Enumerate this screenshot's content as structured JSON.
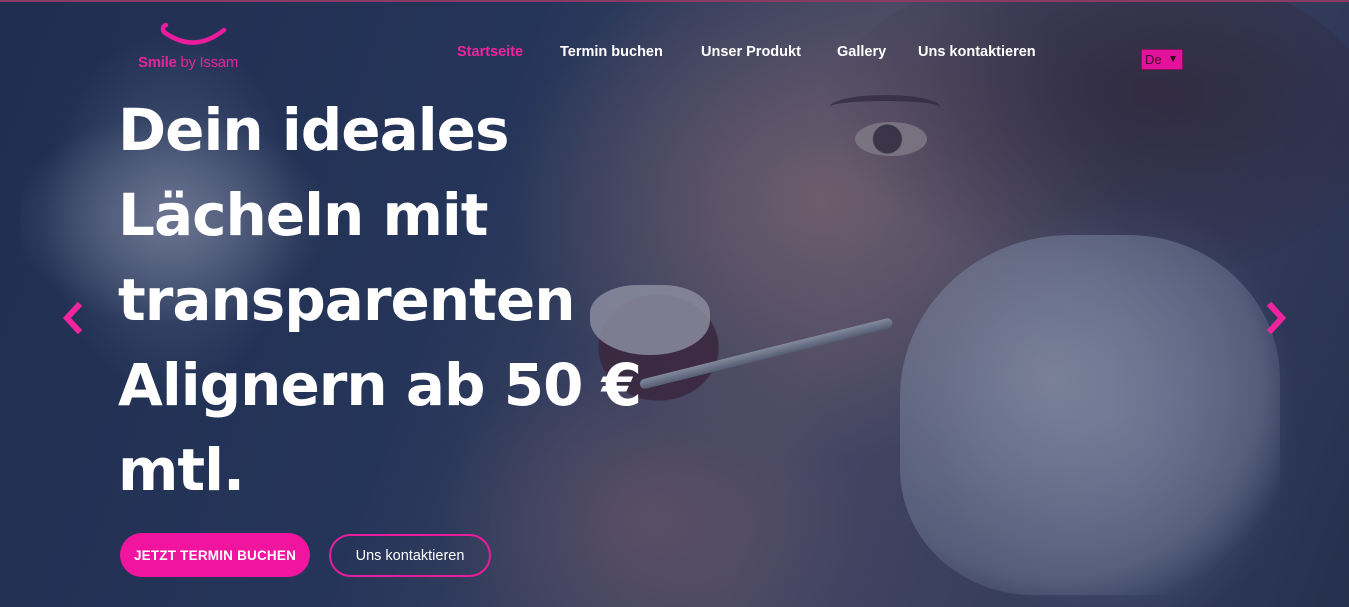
{
  "brand": {
    "logo_bold": "Smile",
    "logo_light": " by Issam",
    "accent_color": "#f0149e"
  },
  "nav": {
    "items": [
      {
        "label": "Startseite",
        "active": true
      },
      {
        "label": "Termin buchen",
        "active": false
      },
      {
        "label": "Unser Produkt",
        "active": false
      },
      {
        "label": "Gallery",
        "active": false
      },
      {
        "label": "Uns kontaktieren",
        "active": false
      }
    ]
  },
  "language": {
    "selected": "De"
  },
  "hero": {
    "headline_lines": [
      "Dein ideales",
      "Lächeln mit",
      "transparenten",
      "Alignern ab 50 €",
      "mtl."
    ],
    "primary_button": "JETZT TERMIN BUCHEN",
    "secondary_button": "Uns kontaktieren"
  },
  "carousel": {
    "prev_icon": "chevron-left-icon",
    "next_icon": "chevron-right-icon",
    "prev_glyph": "‹",
    "next_glyph": "›"
  }
}
